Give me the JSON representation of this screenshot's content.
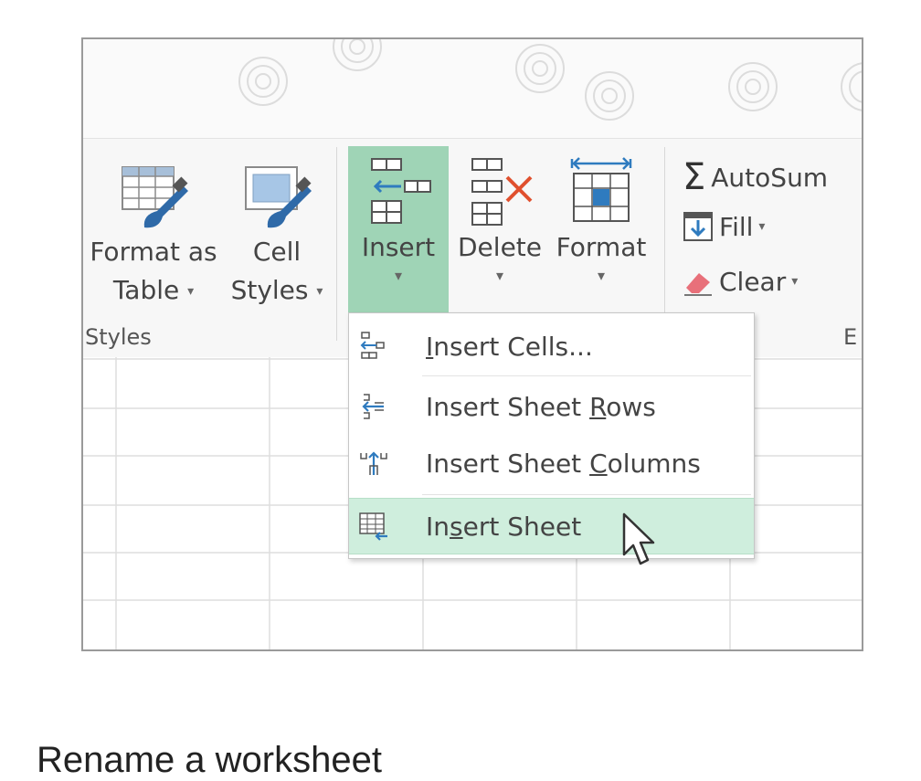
{
  "ribbon": {
    "format_as_table": {
      "line1": "Format as",
      "line2": "Table",
      "icon": "format-as-table-icon"
    },
    "cell_styles": {
      "line1": "Cell",
      "line2": "Styles",
      "icon": "cell-styles-icon"
    },
    "insert": {
      "label": "Insert",
      "icon": "insert-cells-icon"
    },
    "delete": {
      "label": "Delete",
      "icon": "delete-cells-icon"
    },
    "format": {
      "label": "Format",
      "icon": "format-cells-icon"
    },
    "autosum": {
      "label": "AutoSum",
      "icon": "sigma-icon"
    },
    "fill": {
      "label": "Fill",
      "icon": "fill-down-icon"
    },
    "clear": {
      "label": "Clear",
      "icon": "eraser-icon"
    },
    "styles_group": "Styles",
    "editing_group": "E"
  },
  "insert_menu": {
    "items": [
      {
        "pre": "",
        "acc": "I",
        "post": "nsert Cells...",
        "icon": "insert-cells-small-icon"
      },
      {
        "pre": "Insert Sheet ",
        "acc": "R",
        "post": "ows",
        "icon": "insert-rows-icon"
      },
      {
        "pre": "Insert Sheet ",
        "acc": "C",
        "post": "olumns",
        "icon": "insert-columns-icon"
      },
      {
        "pre": "In",
        "acc": "s",
        "post": "ert Sheet",
        "icon": "insert-sheet-icon"
      }
    ],
    "selected_index": 3
  },
  "caption": "Rename a worksheet",
  "colors": {
    "accent": "#9fd4b6",
    "selected": "#cfeedd",
    "icon_blue": "#2f7bbf",
    "delete_red": "#e0502e"
  }
}
